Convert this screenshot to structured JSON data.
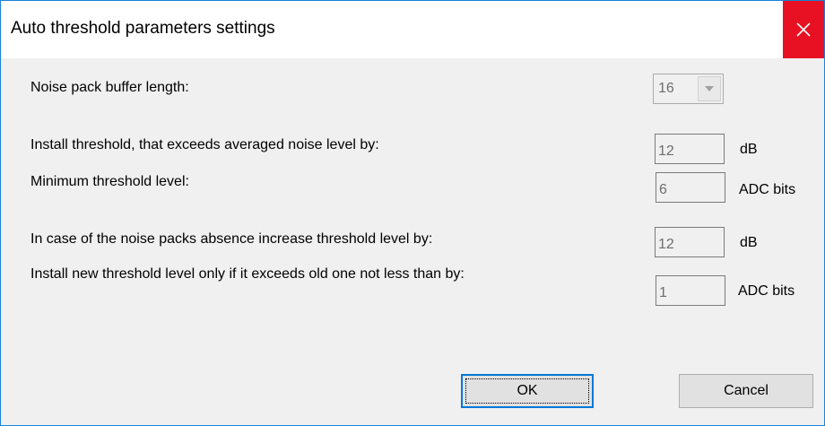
{
  "window": {
    "title": "Auto threshold parameters settings"
  },
  "fields": {
    "buffer_length": {
      "label": "Noise pack buffer length:",
      "value": "16"
    },
    "install_threshold": {
      "label": "Install threshold, that exceeds averaged noise level by:",
      "value": "12",
      "unit": "dB"
    },
    "minimum_threshold": {
      "label": "Minimum threshold level:",
      "value": "6",
      "unit": "ADC bits"
    },
    "absence_increase": {
      "label": "In case of the noise packs absence increase threshold level by:",
      "value": "12",
      "unit": "dB"
    },
    "new_threshold": {
      "label": "Install new threshold level only if it exceeds old one not less than by:",
      "value": "1",
      "unit": "ADC bits"
    }
  },
  "buttons": {
    "ok": "OK",
    "cancel": "Cancel"
  },
  "colors": {
    "close": "#e81123",
    "accent": "#0078d7"
  },
  "icons": {
    "close": "close-icon",
    "dropdown": "chevron-down-icon"
  }
}
